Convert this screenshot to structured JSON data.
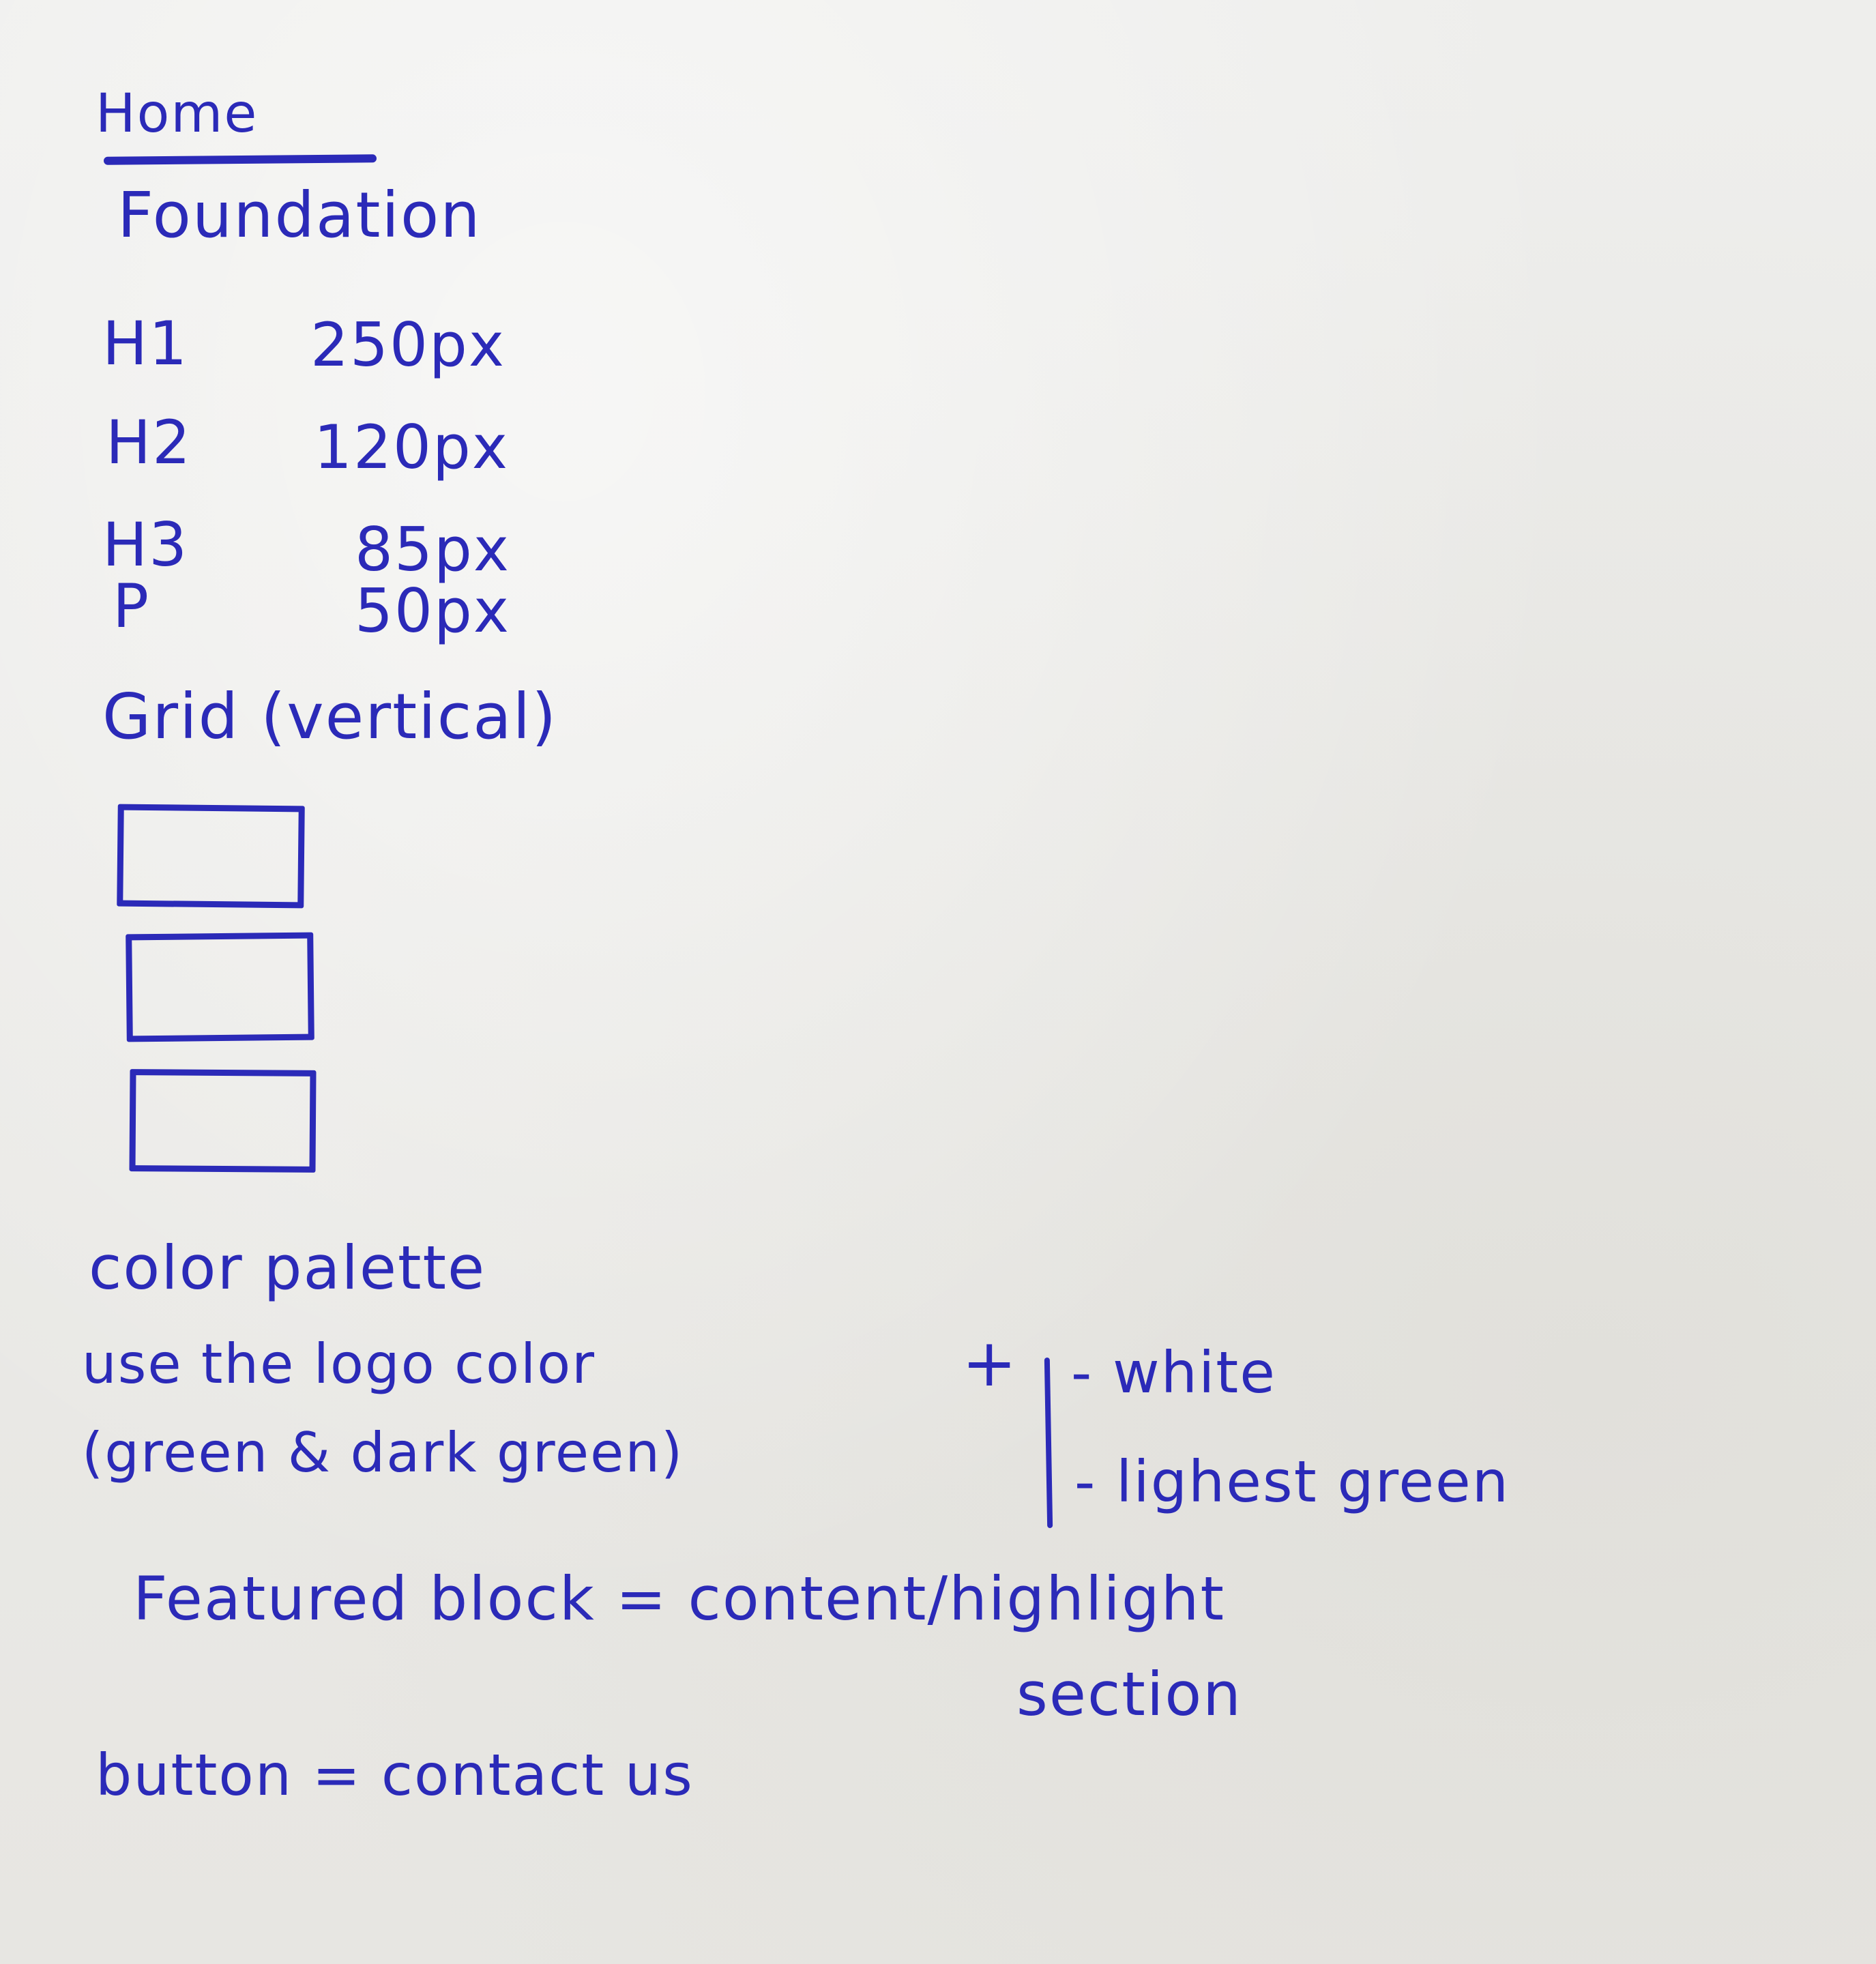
{
  "colors": {
    "ink": "#2b2ab8",
    "paper": "#ececea"
  },
  "title": "Home",
  "foundation": "Foundation",
  "type_specs": [
    {
      "name": "H1",
      "size": "250px"
    },
    {
      "name": "H2",
      "size": "120px"
    },
    {
      "name": "H3",
      "size": "85px"
    },
    {
      "name": "P",
      "size": "50px"
    }
  ],
  "grid": {
    "title": "Grid (vertical)"
  },
  "palette": {
    "title": "color palette",
    "line1": "use the logo color",
    "line2": "(green & dark green)",
    "plus": "+",
    "options": [
      "- white",
      "- lighest green"
    ]
  },
  "featured": {
    "line1": "Featured block = content/highlight",
    "line2": "section"
  },
  "button": {
    "line": "button = contact us"
  }
}
